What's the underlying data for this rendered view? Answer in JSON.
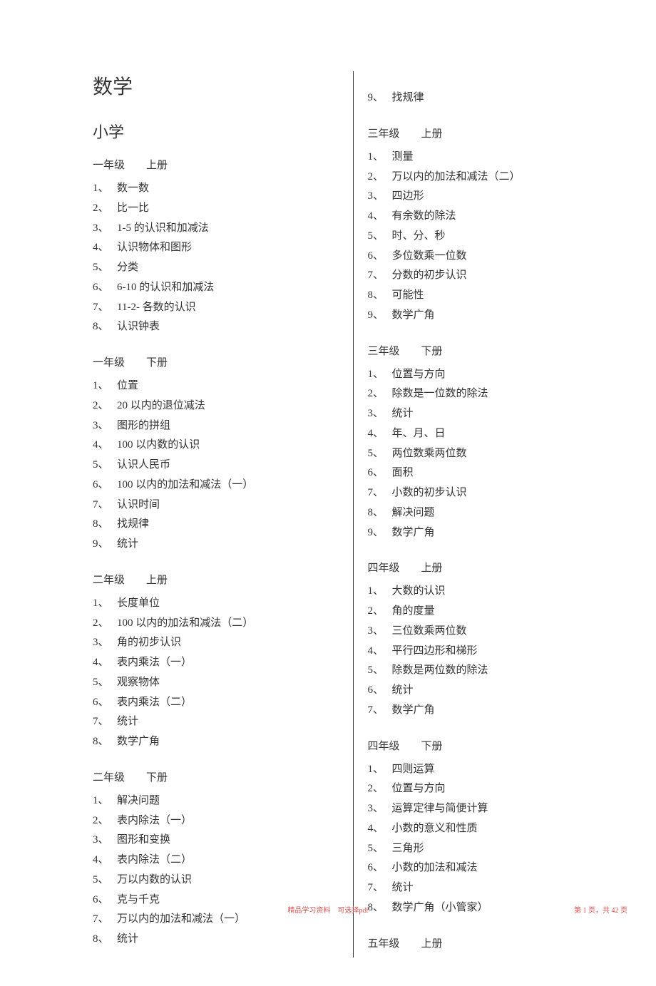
{
  "title": "数学",
  "subtitle": "小学",
  "footer_center": "精品学习资料　可选择pdf",
  "footer_right": "第 1 页，共 42 页",
  "left_column": [
    {
      "header": "一年级　　上册",
      "items": [
        "数一数",
        "比一比",
        "1-5 的认识和加减法",
        "认识物体和图形",
        "分类",
        "6-10 的认识和加减法",
        "11-2- 各数的认识",
        "认识钟表"
      ]
    },
    {
      "header": "一年级　　下册",
      "items": [
        "位置",
        "20 以内的退位减法",
        "图形的拼组",
        "100 以内数的认识",
        "认识人民币",
        "100 以内的加法和减法（一）",
        "认识时间",
        "找规律",
        "统计"
      ]
    },
    {
      "header": "二年级　　上册",
      "items": [
        "长度单位",
        "100 以内的加法和减法（二）",
        "角的初步认识",
        "表内乘法（一）",
        "观察物体",
        "表内乘法（二）",
        "统计",
        "数学广角"
      ]
    },
    {
      "header": "二年级　　下册",
      "items": [
        "解决问题",
        "表内除法（一）",
        "图形和变换",
        "表内除法（二）",
        "万以内数的认识",
        "克与千克",
        "万以内的加法和减法（一）",
        "统计"
      ]
    }
  ],
  "right_column_top": {
    "num": "9、",
    "text": "找规律"
  },
  "right_column": [
    {
      "header": "三年级　　上册",
      "items": [
        "测量",
        "万以内的加法和减法（二）",
        "四边形",
        "有余数的除法",
        "时、分、秒",
        "多位数乘一位数",
        "分数的初步认识",
        "可能性",
        "数学广角"
      ]
    },
    {
      "header": "三年级　　下册",
      "items": [
        "位置与方向",
        "除数是一位数的除法",
        "统计",
        "年、月、日",
        "两位数乘两位数",
        "面积",
        "小数的初步认识",
        "解决问题",
        "数学广角"
      ]
    },
    {
      "header": "四年级　　上册",
      "items": [
        "大数的认识",
        "角的度量",
        "三位数乘两位数",
        "平行四边形和梯形",
        "除数是两位数的除法",
        "统计",
        "数学广角"
      ]
    },
    {
      "header": "四年级　　下册",
      "items": [
        "四则运算",
        "位置与方向",
        "运算定律与简便计算",
        "小数的意义和性质",
        "三角形",
        "小数的加法和减法",
        "统计",
        "数学广角（小管家）"
      ]
    },
    {
      "header": "五年级　　上册",
      "items": []
    }
  ]
}
